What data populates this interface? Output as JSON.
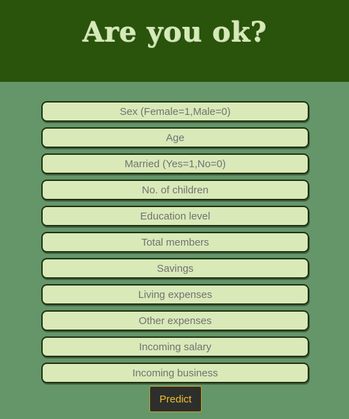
{
  "header": {
    "title": "Are you ok?"
  },
  "form": {
    "fields": [
      {
        "placeholder": "Sex (Female=1,Male=0)",
        "value": ""
      },
      {
        "placeholder": "Age",
        "value": ""
      },
      {
        "placeholder": "Married (Yes=1,No=0)",
        "value": ""
      },
      {
        "placeholder": "No. of children",
        "value": ""
      },
      {
        "placeholder": "Education level",
        "value": ""
      },
      {
        "placeholder": "Total members",
        "value": ""
      },
      {
        "placeholder": "Savings",
        "value": ""
      },
      {
        "placeholder": "Living expenses",
        "value": ""
      },
      {
        "placeholder": "Other expenses",
        "value": ""
      },
      {
        "placeholder": "Incoming salary",
        "value": ""
      },
      {
        "placeholder": "Incoming business",
        "value": ""
      }
    ],
    "submit_label": "Predict"
  },
  "colors": {
    "header_bg": "#2a540b",
    "page_bg": "#64966a",
    "title_text": "#d6eab9",
    "field_bg": "#d9e9b8",
    "button_bg": "#2d2f2c",
    "button_text": "#efbe32"
  }
}
